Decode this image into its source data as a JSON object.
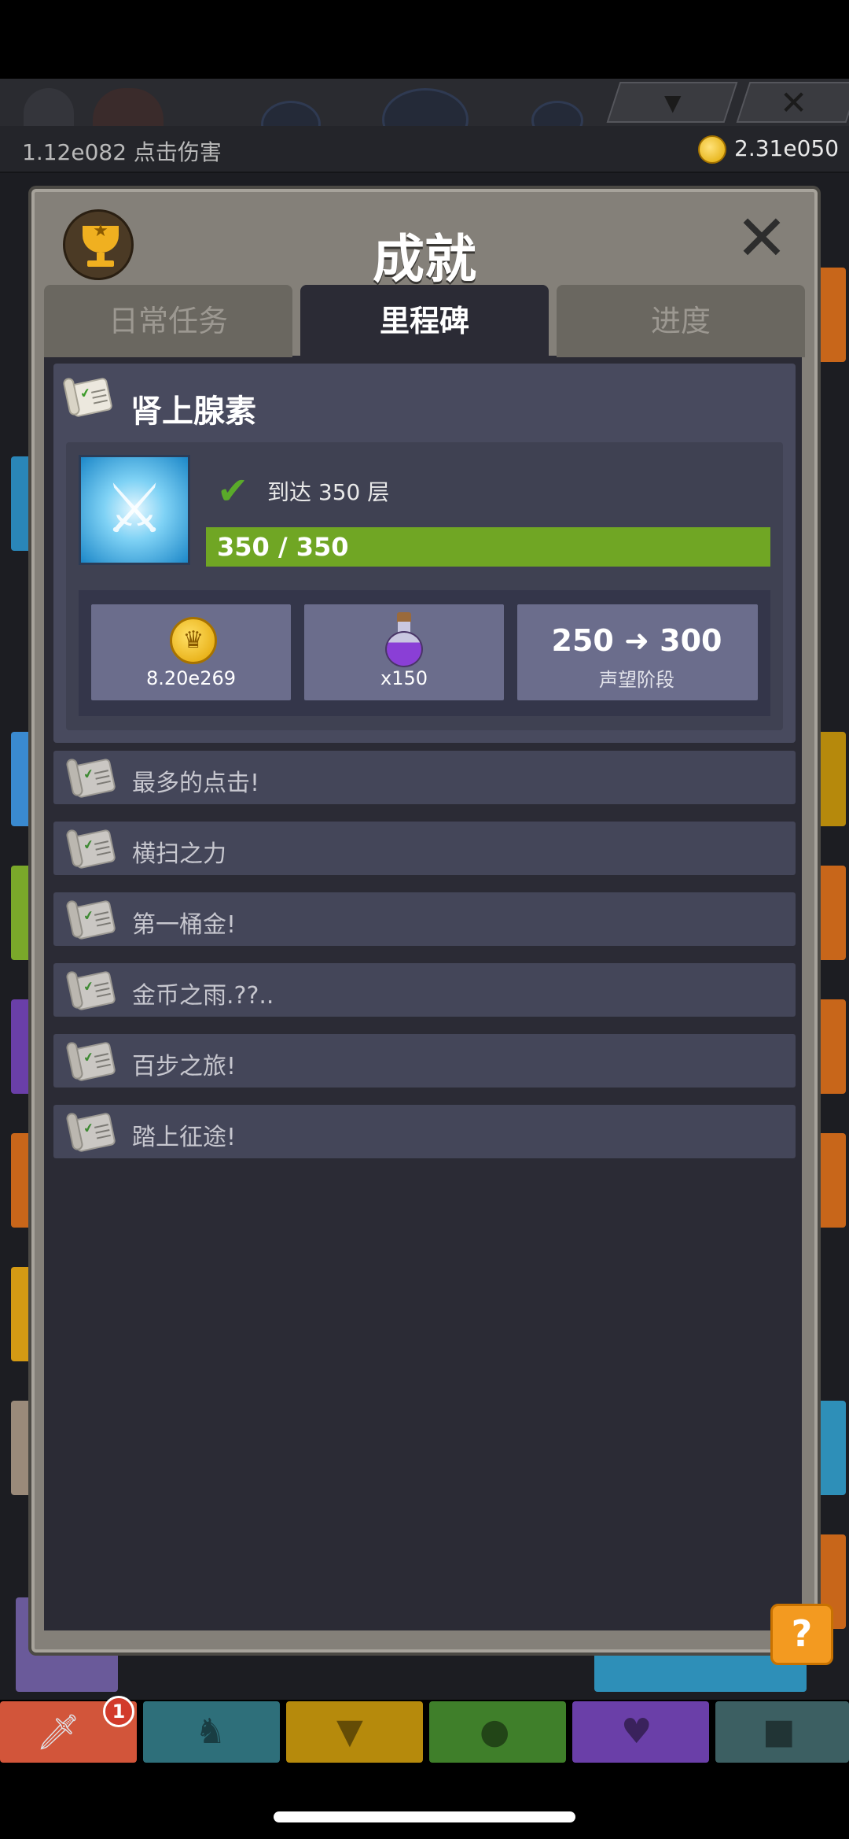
{
  "top_bar": {
    "damage_text": "1.12e082 点击伤害",
    "gold_text": "2.31e050"
  },
  "modal": {
    "title": "成就",
    "close_icon": "close-icon",
    "tabs": [
      {
        "label": "日常任务",
        "active": false
      },
      {
        "label": "里程碑",
        "active": true
      },
      {
        "label": "进度",
        "active": false
      }
    ]
  },
  "featured": {
    "title": "肾上腺素",
    "goal": "到达 350 层",
    "progress_text": "350 / 350",
    "progress_fraction": 1.0,
    "rewards": {
      "gold_amount": "8.20e269",
      "potion_amount": "x150",
      "prestige_from": "250",
      "prestige_to": "300",
      "prestige_label": "声望阶段"
    }
  },
  "achievements": [
    {
      "label": "最多的点击!"
    },
    {
      "label": "横扫之力"
    },
    {
      "label": "第一桶金!"
    },
    {
      "label": "金币之雨.??.."
    },
    {
      "label": "百步之旅!"
    },
    {
      "label": "踏上征途!"
    }
  ],
  "help_button": {
    "label": "?"
  },
  "bottom_nav": {
    "badge_count": "1",
    "colors": [
      "#d2553a",
      "#2e6f7a",
      "#b68a0c",
      "#3f7f2a",
      "#6a3fa8",
      "#3c5f62"
    ]
  }
}
